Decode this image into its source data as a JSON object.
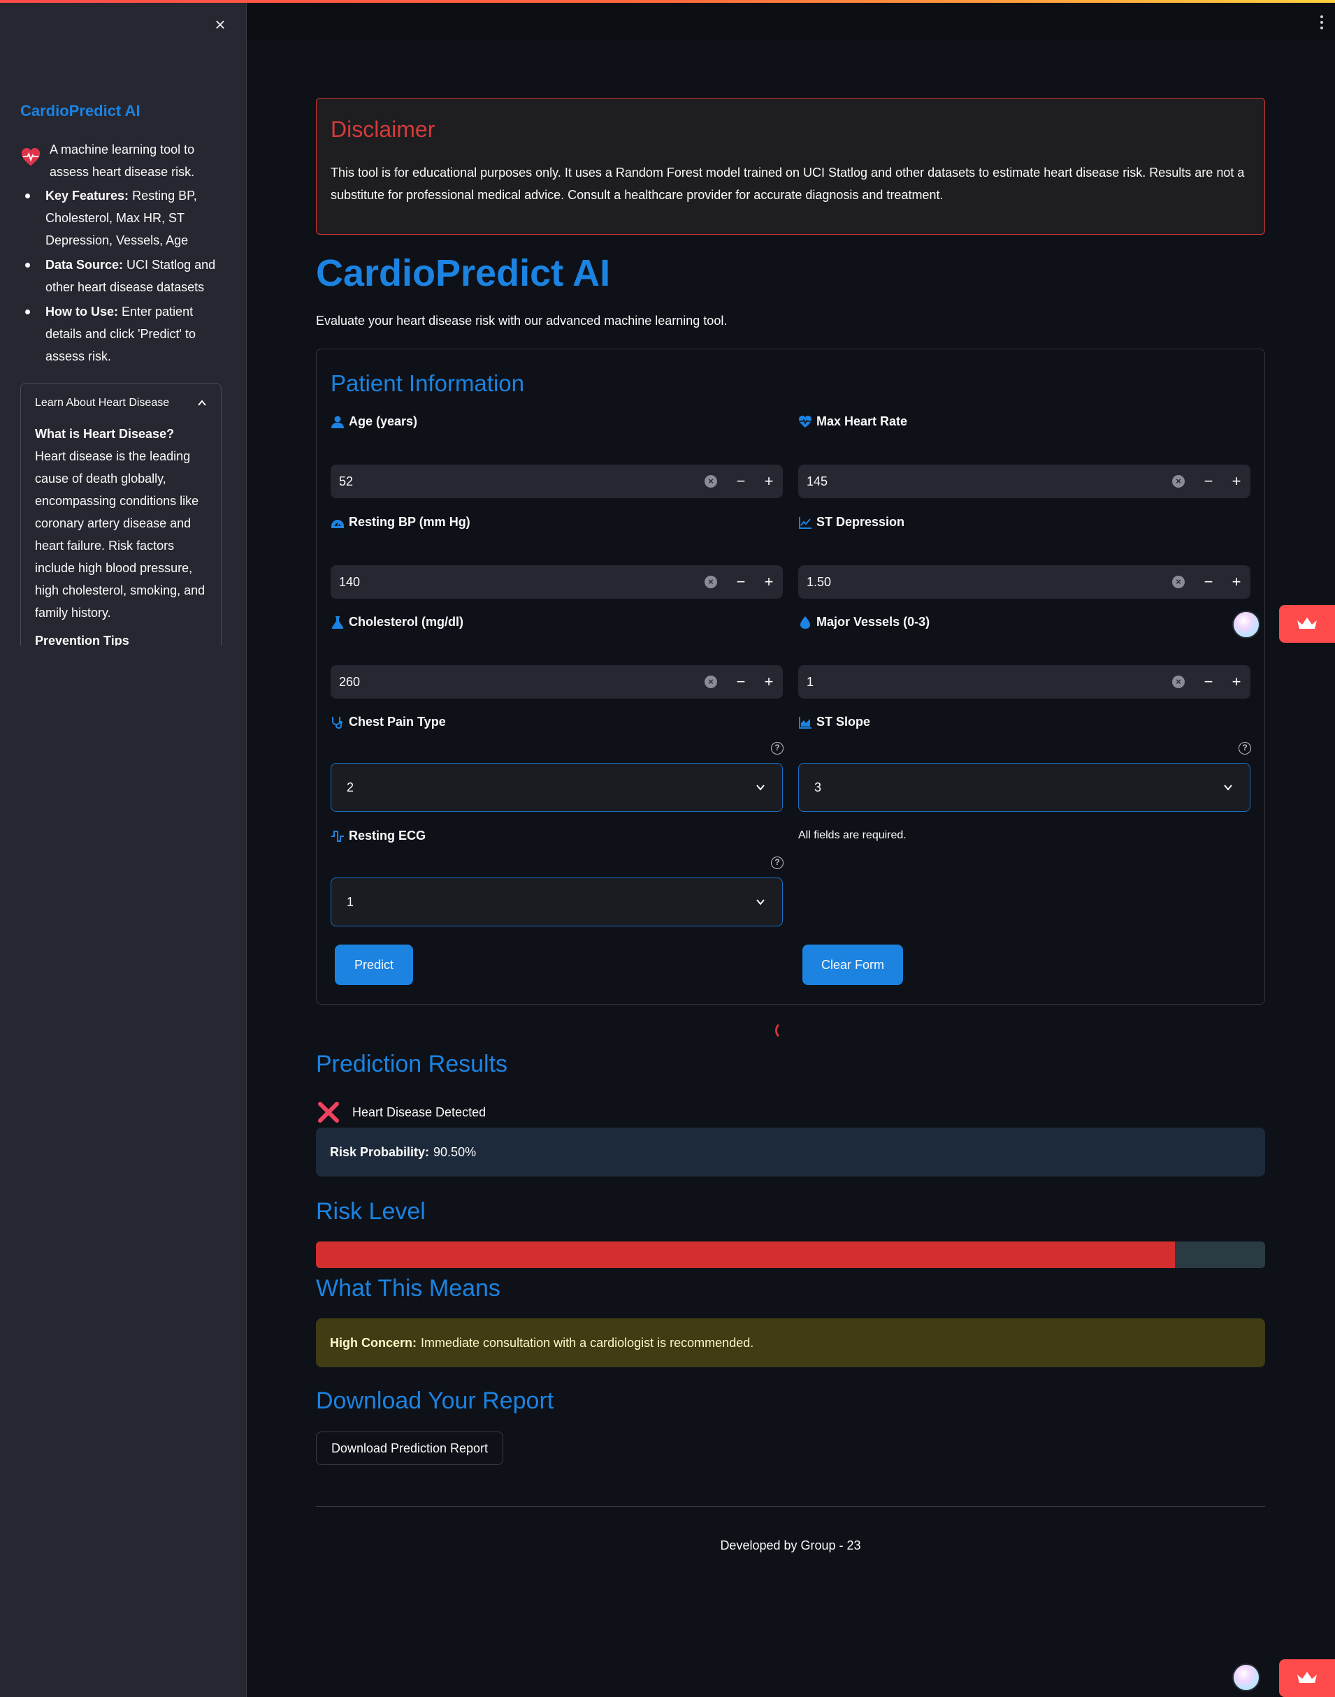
{
  "sidebar": {
    "title": "CardioPredict AI",
    "intro": "A machine learning tool to assess heart disease risk.",
    "items": [
      {
        "label": "Key Features:",
        "text": " Resting BP, Cholesterol, Max HR, ST Depression, Vessels, Age"
      },
      {
        "label": "Data Source:",
        "text": " UCI Statlog and other heart disease datasets"
      },
      {
        "label": "How to Use:",
        "text": " Enter patient details and click 'Predict' to assess risk."
      }
    ],
    "expander": {
      "label": "Learn About Heart Disease",
      "heading": "What is Heart Disease?",
      "body": " Heart disease is the leading cause of death globally, encompassing conditions like coronary artery disease and heart failure. Risk factors include high blood pressure, high cholesterol, smoking, and family history.",
      "next_heading": "Prevention Tips"
    }
  },
  "disclaimer": {
    "title": "Disclaimer",
    "text": "This tool is for educational purposes only. It uses a Random Forest model trained on UCI Statlog and other datasets to estimate heart disease risk. Results are not a substitute for professional medical advice. Consult a healthcare provider for accurate diagnosis and treatment."
  },
  "app": {
    "title": "CardioPredict AI",
    "subtitle": "Evaluate your heart disease risk with our advanced machine learning tool."
  },
  "form": {
    "title": "Patient Information",
    "age": {
      "label": "Age (years)",
      "value": "52",
      "icon": "user-icon"
    },
    "max_hr": {
      "label": "Max Heart Rate",
      "value": "145",
      "icon": "heart-pulse-icon"
    },
    "resting_bp": {
      "label": "Resting BP (mm Hg)",
      "value": "140",
      "icon": "gauge-icon"
    },
    "st_depression": {
      "label": "ST Depression",
      "value": "1.50",
      "icon": "line-chart-icon"
    },
    "cholesterol": {
      "label": "Cholesterol (mg/dl)",
      "value": "260",
      "icon": "flask-icon"
    },
    "vessels": {
      "label": "Major Vessels (0-3)",
      "value": "1",
      "icon": "drop-icon"
    },
    "chest_pain": {
      "label": "Chest Pain Type",
      "value": "2",
      "icon": "stethoscope-icon"
    },
    "st_slope": {
      "label": "ST Slope",
      "value": "3",
      "icon": "area-chart-icon"
    },
    "resting_ecg": {
      "label": "Resting ECG",
      "value": "1",
      "icon": "ecg-icon"
    },
    "note": "All fields are required.",
    "predict_label": "Predict",
    "clear_label": "Clear Form"
  },
  "results": {
    "title": "Prediction Results",
    "status": "Heart Disease Detected",
    "risk_label": "Risk Probability:",
    "risk_value": "90.50%",
    "risk_fraction": 0.905
  },
  "risk_level": {
    "title": "Risk Level",
    "fill_color": "#d32f2f"
  },
  "meaning": {
    "title": "What This Means",
    "label": "High Concern:",
    "text": "Immediate consultation with a cardiologist is recommended."
  },
  "report": {
    "title": "Download Your Report",
    "button_label": "Download Prediction Report"
  },
  "footer": {
    "text": "Developed by Group - 23"
  },
  "colors": {
    "accent": "#1c83e1",
    "danger": "#d32f2f",
    "deploy": "#ff4b4b"
  }
}
